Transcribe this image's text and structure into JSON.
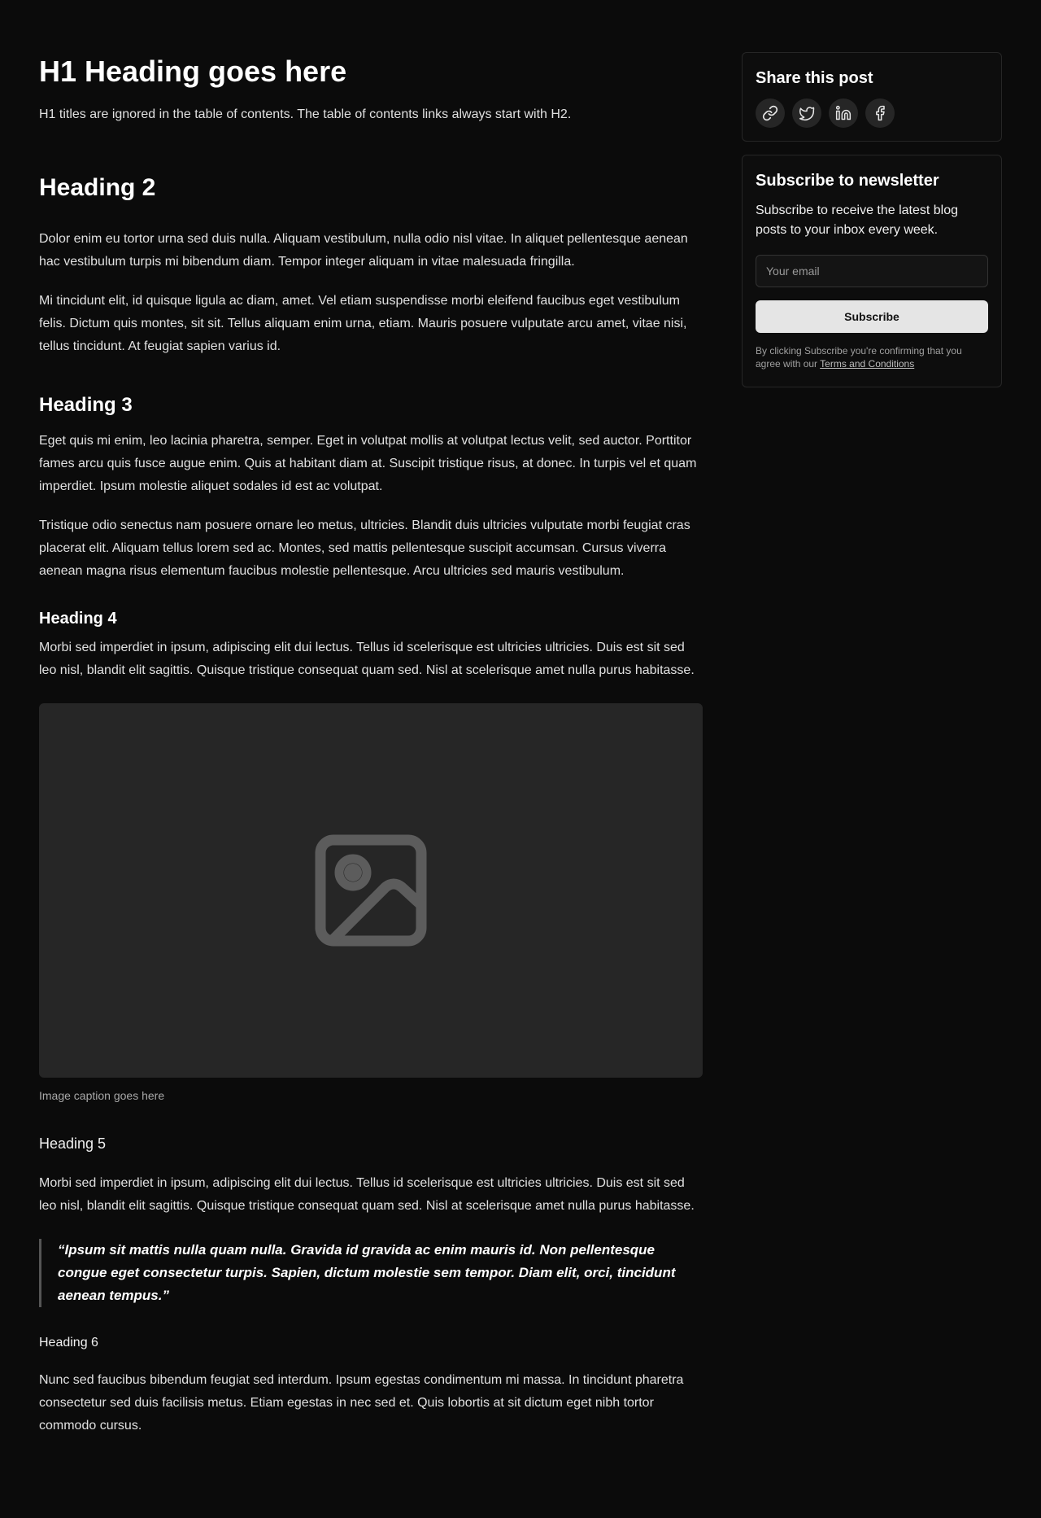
{
  "article": {
    "h1": "H1 Heading goes here",
    "intro": "H1 titles are ignored in the table of contents. The table of contents links always start with H2.",
    "h2": "Heading 2",
    "p1": "Dolor enim eu tortor urna sed duis nulla. Aliquam vestibulum, nulla odio nisl vitae. In aliquet pellentesque aenean hac vestibulum turpis mi bibendum diam. Tempor integer aliquam in vitae malesuada fringilla.",
    "p2": "Mi tincidunt elit, id quisque ligula ac diam, amet. Vel etiam suspendisse morbi eleifend faucibus eget vestibulum felis. Dictum quis montes, sit sit. Tellus aliquam enim urna, etiam. Mauris posuere vulputate arcu amet, vitae nisi, tellus tincidunt. At feugiat sapien varius id.",
    "h3": "Heading 3",
    "p3": "Eget quis mi enim, leo lacinia pharetra, semper. Eget in volutpat mollis at volutpat lectus velit, sed auctor. Porttitor fames arcu quis fusce augue enim. Quis at habitant diam at. Suscipit tristique risus, at donec. In turpis vel et quam imperdiet. Ipsum molestie aliquet sodales id est ac volutpat.",
    "p4": "Tristique odio senectus nam posuere ornare leo metus, ultricies. Blandit duis ultricies vulputate morbi feugiat cras placerat elit. Aliquam tellus lorem sed ac. Montes, sed mattis pellentesque suscipit accumsan. Cursus viverra aenean magna risus elementum faucibus molestie pellentesque. Arcu ultricies sed mauris vestibulum.",
    "h4": "Heading 4",
    "p5": "Morbi sed imperdiet in ipsum, adipiscing elit dui lectus. Tellus id scelerisque est ultricies ultricies. Duis est sit sed leo nisl, blandit elit sagittis. Quisque tristique consequat quam sed. Nisl at scelerisque amet nulla purus habitasse.",
    "image_icon": "image-placeholder-icon",
    "caption": "Image caption goes here",
    "h5": "Heading 5",
    "p6": "Morbi sed imperdiet in ipsum, adipiscing elit dui lectus. Tellus id scelerisque est ultricies ultricies. Duis est sit sed leo nisl, blandit elit sagittis. Quisque tristique consequat quam sed. Nisl at scelerisque amet nulla purus habitasse.",
    "quote": "“Ipsum sit mattis nulla quam nulla. Gravida id gravida ac enim mauris id. Non pellentesque congue eget consectetur turpis. Sapien, dictum molestie sem tempor. Diam elit, orci, tincidunt aenean tempus.”",
    "h6": "Heading 6",
    "p7": "Nunc sed faucibus bibendum feugiat sed interdum. Ipsum egestas condimentum mi massa. In tincidunt pharetra consectetur sed duis facilisis metus. Etiam egestas in nec sed et. Quis lobortis at sit dictum eget nibh tortor commodo cursus."
  },
  "share": {
    "title": "Share this post",
    "icons": [
      "link-icon",
      "twitter-icon",
      "linkedin-icon",
      "facebook-icon"
    ]
  },
  "newsletter": {
    "title": "Subscribe to newsletter",
    "text": "Subscribe to receive the latest blog posts to your inbox every week.",
    "email_placeholder": "Your email",
    "button_label": "Subscribe",
    "terms_prefix": "By clicking Subscribe you're confirming that you agree with our ",
    "terms_link": "Terms and Conditions"
  },
  "colors": {
    "background": "#0b0b0b",
    "image_placeholder": "#262626",
    "button_bg": "#e5e5e5"
  }
}
